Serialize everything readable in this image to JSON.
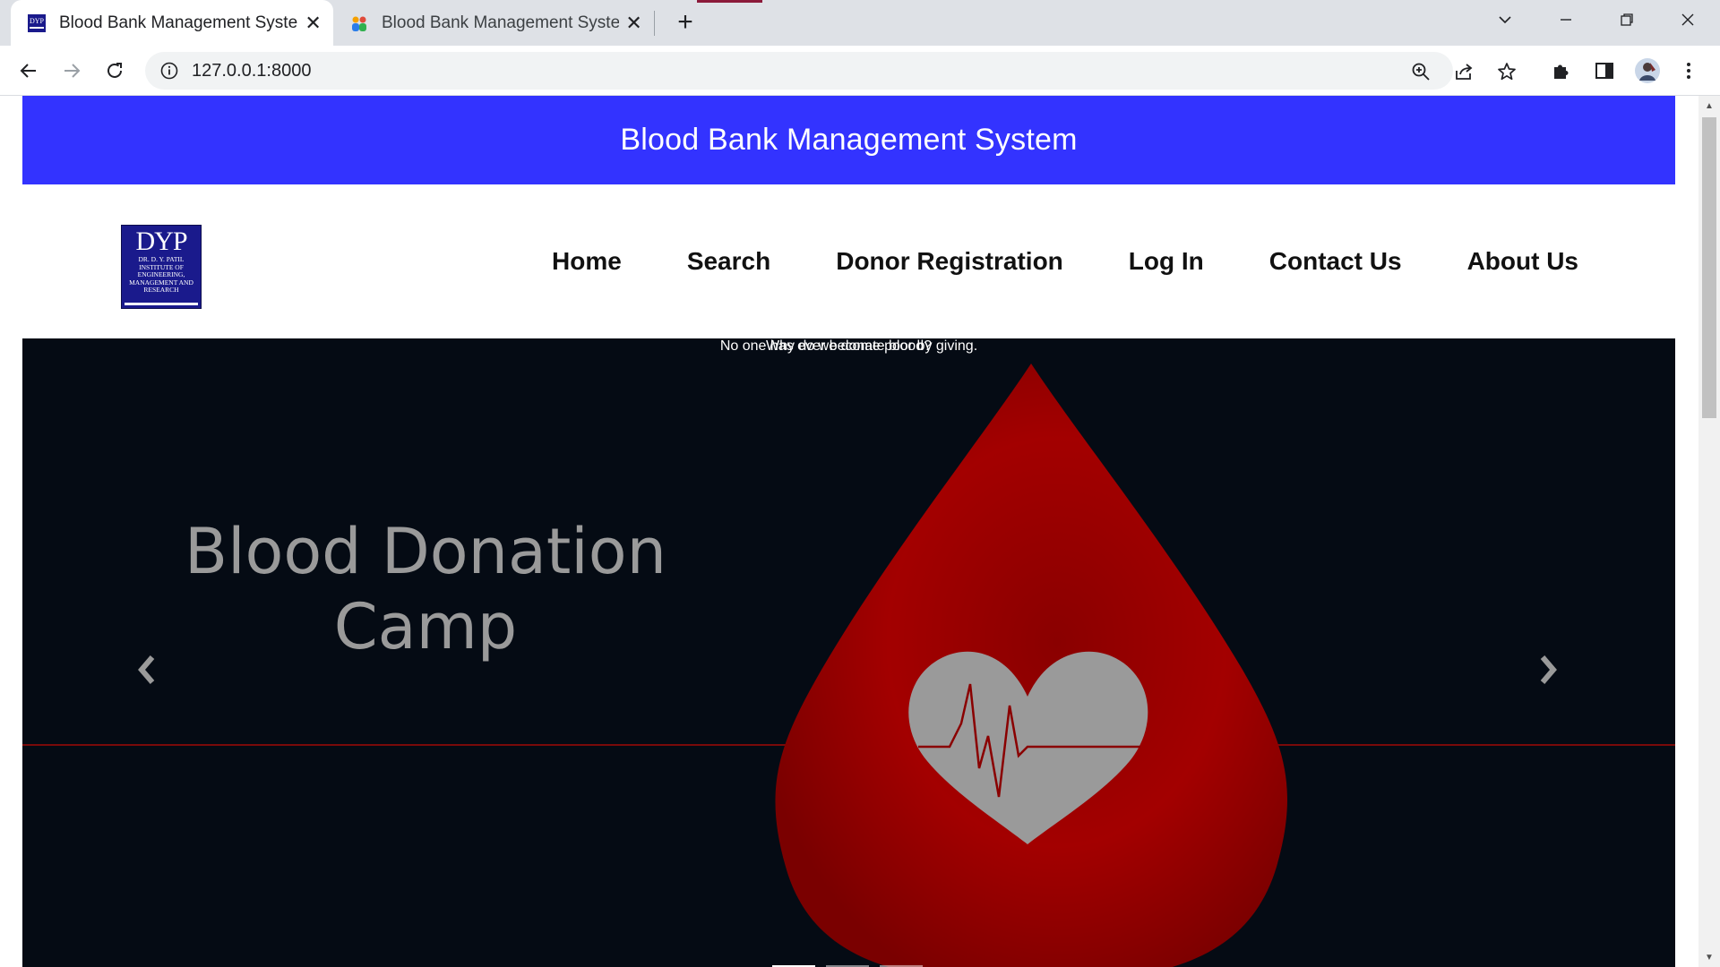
{
  "browser": {
    "tabs": [
      {
        "title": "Blood Bank Management System",
        "active": true
      },
      {
        "title": "Blood Bank Management System",
        "active": false
      }
    ],
    "url": "127.0.0.1:8000"
  },
  "page": {
    "banner_title": "Blood Bank Management System",
    "logo": {
      "text": "DYP",
      "subtext": "DR. D. Y. PATIL INSTITUTE OF ENGINEERING, MANAGEMENT AND RESEARCH"
    },
    "nav": [
      {
        "label": "Home"
      },
      {
        "label": "Search"
      },
      {
        "label": "Donor Registration"
      },
      {
        "label": "Log In"
      },
      {
        "label": "Contact Us"
      },
      {
        "label": "About Us"
      }
    ],
    "carousel": {
      "slide_image_text_line1": "Blood Donation",
      "slide_image_text_line2": "Camp",
      "caption_heading": "Why do we donate blood?",
      "caption_text": "No one has ever become poor by giving.",
      "slide_count": 3,
      "active_slide": 1
    }
  },
  "colors": {
    "banner": "#3333ff",
    "carousel_bg": "#050b14",
    "drop_red": "#a30000",
    "heart_gray": "#9a9a9a",
    "logo_blue": "#1a1a8c"
  }
}
